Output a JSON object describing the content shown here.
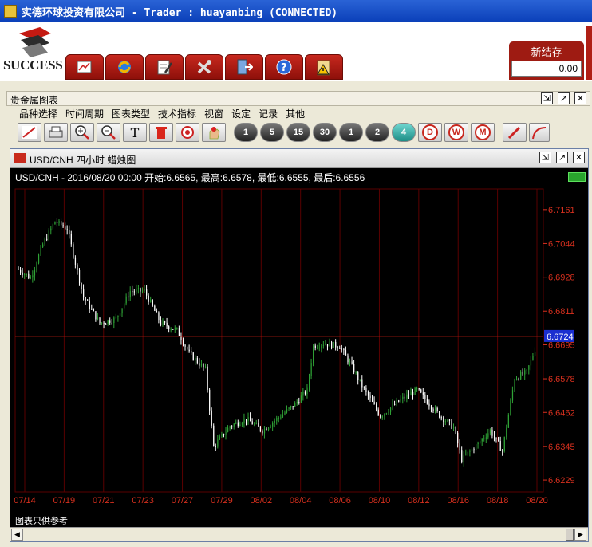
{
  "window": {
    "title": "实德环球投资有限公司 -  Trader : huayanbing (CONNECTED)"
  },
  "logo": {
    "text": "SUCCESS"
  },
  "toolbar": {
    "buttons": [
      {
        "name": "chart-tool-button",
        "icon": "chart-icon"
      },
      {
        "name": "refresh-button",
        "icon": "refresh-icon"
      },
      {
        "name": "edit-document-button",
        "icon": "edit-document-icon"
      },
      {
        "name": "tools-button",
        "icon": "tools-icon"
      },
      {
        "name": "exit-button",
        "icon": "exit-door-icon"
      },
      {
        "name": "help-button",
        "icon": "help-icon"
      },
      {
        "name": "warning-clipboard-button",
        "icon": "warning-clipboard-icon"
      }
    ],
    "settlement": {
      "label": "新结存",
      "value": "0.00"
    }
  },
  "panel": {
    "title": "贵金属图表"
  },
  "menu": {
    "items": [
      "品种选择",
      "时间周期",
      "图表类型",
      "技术指标",
      "视窗",
      "设定",
      "记录",
      "其他"
    ]
  },
  "chart_toolbar": {
    "tools": [
      "line-tool-icon",
      "print-icon",
      "zoom-in-icon",
      "zoom-out-icon",
      "text-tool-icon",
      "delete-icon",
      "record-icon",
      "hand-icon"
    ],
    "periods": [
      "1",
      "5",
      "15",
      "30",
      "1",
      "2",
      "4",
      "D",
      "W",
      "M"
    ]
  },
  "chart_window": {
    "title": "USD/CNH 四小时 蜡烛图",
    "info": "USD/CNH - 2016/08/20 00:00 开始:6.6565, 最高:6.6578, 最低:6.6555, 最后:6.6556",
    "disclaimer": "图表只供参考"
  },
  "colors": {
    "up": "#2fa336",
    "down": "#ffffff",
    "grid": "#5a0000",
    "axis": "#d8301e",
    "price_line": "#b01a10",
    "price_tag": "#1a2fd0"
  },
  "chart_data": {
    "type": "candlestick",
    "symbol": "USD/CNH",
    "timeframe": "四小时",
    "x_tick_labels": [
      "07/14",
      "07/19",
      "07/21",
      "07/23",
      "07/27",
      "07/29",
      "08/02",
      "08/04",
      "08/06",
      "08/10",
      "08/12",
      "08/16",
      "08/18",
      "08/20"
    ],
    "y_tick_labels": [
      "6.7161",
      "6.7044",
      "6.6928",
      "6.6811",
      "6.6695",
      "6.6578",
      "6.6462",
      "6.6345",
      "6.6229"
    ],
    "ylim": [
      6.6188,
      6.7232
    ],
    "current_price": "6.6724",
    "last_bar": {
      "open": 6.6565,
      "high": 6.6578,
      "low": 6.6555,
      "close": 6.6556
    },
    "close_path": [
      [
        0,
        6.6955
      ],
      [
        6,
        6.6925
      ],
      [
        12,
        6.704
      ],
      [
        18,
        6.712
      ],
      [
        24,
        6.7095
      ],
      [
        32,
        6.686
      ],
      [
        40,
        6.677
      ],
      [
        48,
        6.6785
      ],
      [
        55,
        6.688
      ],
      [
        62,
        6.688
      ],
      [
        70,
        6.677
      ],
      [
        78,
        6.6745
      ],
      [
        84,
        6.6665
      ],
      [
        92,
        6.661
      ],
      [
        96,
        6.6345
      ],
      [
        104,
        6.6415
      ],
      [
        112,
        6.644
      ],
      [
        120,
        6.64
      ],
      [
        128,
        6.6445
      ],
      [
        136,
        6.649
      ],
      [
        142,
        6.654
      ],
      [
        145,
        6.669
      ],
      [
        150,
        6.67
      ],
      [
        158,
        6.669
      ],
      [
        164,
        6.662
      ],
      [
        170,
        6.654
      ],
      [
        178,
        6.645
      ],
      [
        188,
        6.6505
      ],
      [
        196,
        6.654
      ],
      [
        206,
        6.646
      ],
      [
        214,
        6.641
      ],
      [
        218,
        6.63
      ],
      [
        226,
        6.6355
      ],
      [
        232,
        6.64
      ],
      [
        238,
        6.633
      ],
      [
        244,
        6.658
      ],
      [
        250,
        6.66
      ],
      [
        254,
        6.668
      ]
    ]
  }
}
